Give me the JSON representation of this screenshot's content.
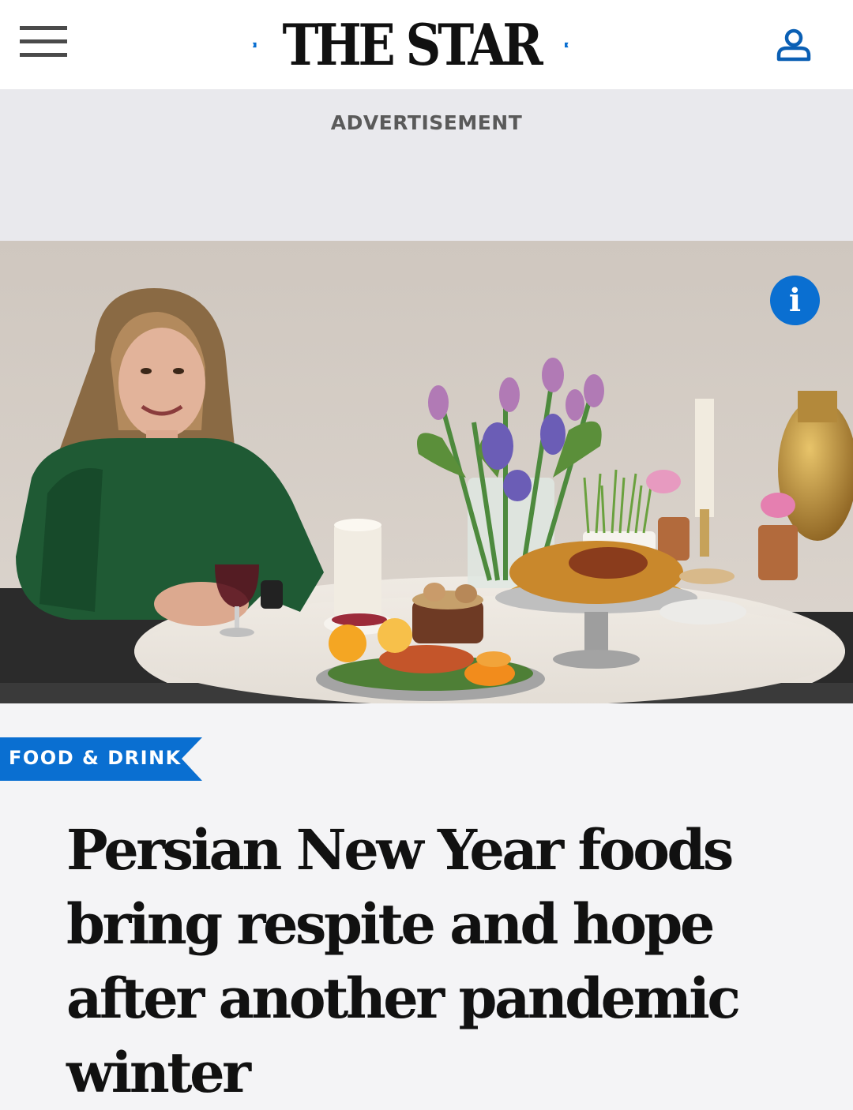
{
  "header": {
    "logo_text": "THE STAR",
    "menu_icon": "hamburger-menu-icon",
    "account_icon": "user-account-icon",
    "brand_color": "#0a6fd1"
  },
  "ad": {
    "label": "ADVERTISEMENT"
  },
  "hero": {
    "info_icon": "info-icon",
    "info_glyph": "i"
  },
  "article": {
    "section_tag": "FOOD & DRINK",
    "headline": "Persian New Year foods bring respite and hope after another pandemic winter"
  }
}
